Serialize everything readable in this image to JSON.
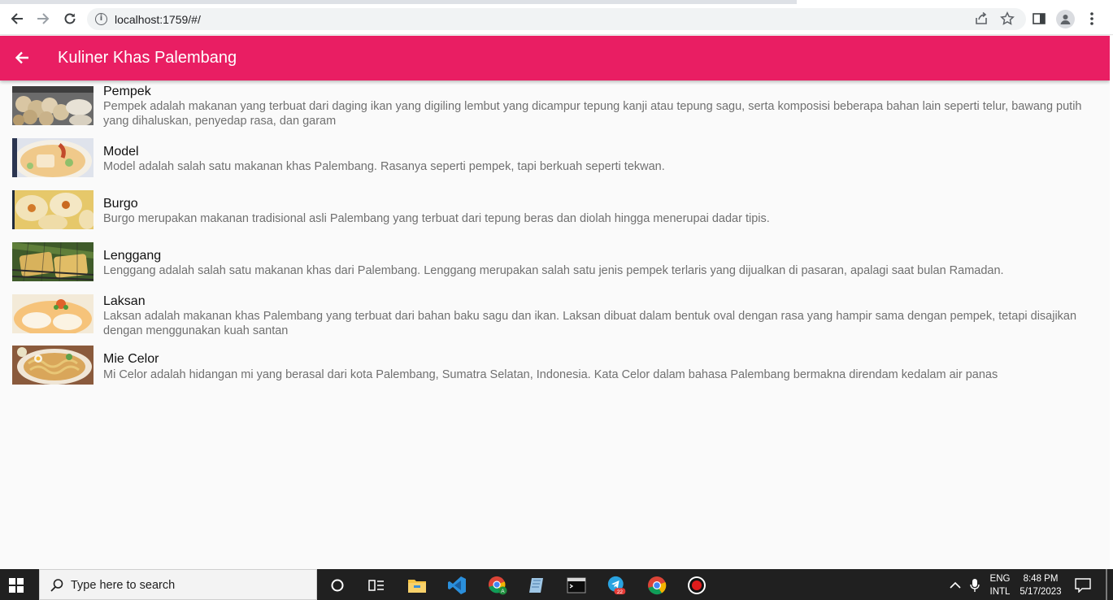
{
  "browser": {
    "url": "localhost:1759/#/",
    "icons": [
      "back-arrow-icon",
      "forward-arrow-icon",
      "reload-icon",
      "info-icon",
      "share-icon",
      "star-icon",
      "side-panel-icon",
      "profile-icon",
      "kebab-menu-icon"
    ]
  },
  "app": {
    "title": "Kuliner Khas Palembang",
    "accent": "#e91e63",
    "back_icon": "arrow-left-icon"
  },
  "items": [
    {
      "name": "Pempek",
      "description": "Pempek adalah makanan yang terbuat dari daging ikan yang digiling lembut yang dicampur tepung kanji atau tepung sagu, serta komposisi beberapa bahan lain seperti telur, bawang putih yang dihaluskan, penyedap rasa, dan garam"
    },
    {
      "name": "Model",
      "description": "Model adalah salah satu makanan khas Palembang. Rasanya seperti pempek, tapi berkuah seperti tekwan."
    },
    {
      "name": "Burgo",
      "description": "Burgo merupakan makanan tradisional asli Palembang yang terbuat dari tepung beras dan diolah hingga menerupai dadar tipis."
    },
    {
      "name": "Lenggang",
      "description": "Lenggang adalah salah satu makanan khas dari Palembang. Lenggang merupakan salah satu jenis pempek terlaris yang dijualkan di pasaran, apalagi saat bulan Ramadan."
    },
    {
      "name": "Laksan",
      "description": "Laksan adalah makanan khas Palembang yang terbuat dari bahan baku sagu dan ikan. Laksan dibuat dalam bentuk oval dengan rasa yang hampir sama dengan pempek, tetapi disajikan dengan menggunakan kuah santan"
    },
    {
      "name": "Mie Celor",
      "description": "Mi Celor adalah hidangan mi yang berasal dari kota Palembang, Sumatra Selatan, Indonesia. Kata Celor dalam bahasa Palembang bermakna direndam kedalam air panas"
    }
  ],
  "taskbar": {
    "search_placeholder": "Type here to search",
    "telegram_badge": "22",
    "chrome_profile_badge": "A",
    "language": "ENG",
    "layout": "INTL",
    "time": "8:48 PM",
    "date": "5/17/2023"
  }
}
